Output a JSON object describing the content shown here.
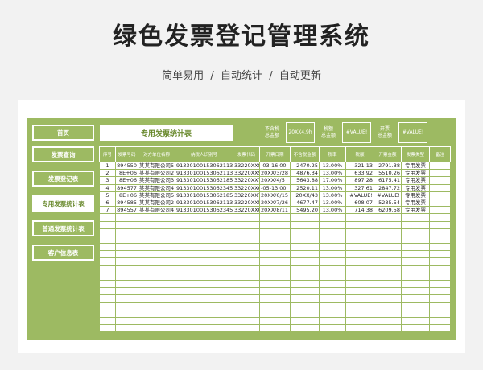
{
  "hero": {
    "title": "绿色发票登记管理系统",
    "subtitle": "简单易用  /  自动统计  /  自动更新"
  },
  "nav": [
    {
      "label": "首页",
      "active": false
    },
    {
      "label": "发票查询",
      "active": false
    },
    {
      "label": "发票登记表",
      "active": false
    },
    {
      "label": "专用发票统计表",
      "active": true
    },
    {
      "label": "普通发票统计表",
      "active": false
    },
    {
      "label": "客户信息表",
      "active": false
    }
  ],
  "sheet": {
    "title": "专用发票统计表",
    "stats": [
      {
        "label": "不含税\n总金额",
        "value": "20XX4.9h"
      },
      {
        "label": "税额\n总金额",
        "value": "#VALUE!"
      },
      {
        "label": "开票\n总金额",
        "value": "#VALUE!"
      }
    ],
    "columns": [
      "序号",
      "发票号码",
      "对方单位名称",
      "纳税人识别号",
      "发票代码",
      "开票日期",
      "不含税金额",
      "税率",
      "税额",
      "开票金额",
      "发票类型",
      "备注"
    ],
    "rows": [
      [
        "1",
        "894550",
        "某某有限公司5",
        "91330100153062113",
        "33220XX8.0",
        "-03-16 00",
        "2470.25",
        "13.00%",
        "321.13",
        "2791.38",
        "专用发票",
        ""
      ],
      [
        "2",
        "8E+06",
        "某某有限公司2",
        "91330100153062113",
        "33220XX5.0",
        "20XX/3/28",
        "4876.34",
        "13.00%",
        "633.92",
        "5510.26",
        "专用发票",
        ""
      ],
      [
        "3",
        "8E+06",
        "某某有限公司3",
        "91330100153062185",
        "33220XX7.0",
        "20XX/4/5",
        "5643.88",
        "17.00%",
        "897.28",
        "6175.41",
        "专用发票",
        ""
      ],
      [
        "4",
        "894577",
        "某某有限公司4",
        "91330100153062345",
        "33220XX0.0",
        "-05-13 00",
        "2520.11",
        "13.00%",
        "327.61",
        "2847.72",
        "专用发票",
        ""
      ],
      [
        "5",
        "8E+06",
        "某某有限公司5",
        "91330100153062185",
        "33220XX7.0",
        "20XX/6/15",
        "20XX/43",
        "13.00%",
        "#VALUE!",
        "#VALUE!",
        "专用发票",
        ""
      ],
      [
        "6",
        "894585",
        "某某有限公司2",
        "91330100153062113",
        "33220XX5.0",
        "20XX/7/26",
        "4677.47",
        "13.00%",
        "608.07",
        "5285.54",
        "专用发票",
        ""
      ],
      [
        "7",
        "894557",
        "某某有限公司4",
        "91330100153062345",
        "33220XX0.0",
        "20XX/8/11",
        "5495.20",
        "13.00%",
        "714.38",
        "6209.58",
        "专用发票",
        ""
      ]
    ],
    "empty_rows": 16
  }
}
